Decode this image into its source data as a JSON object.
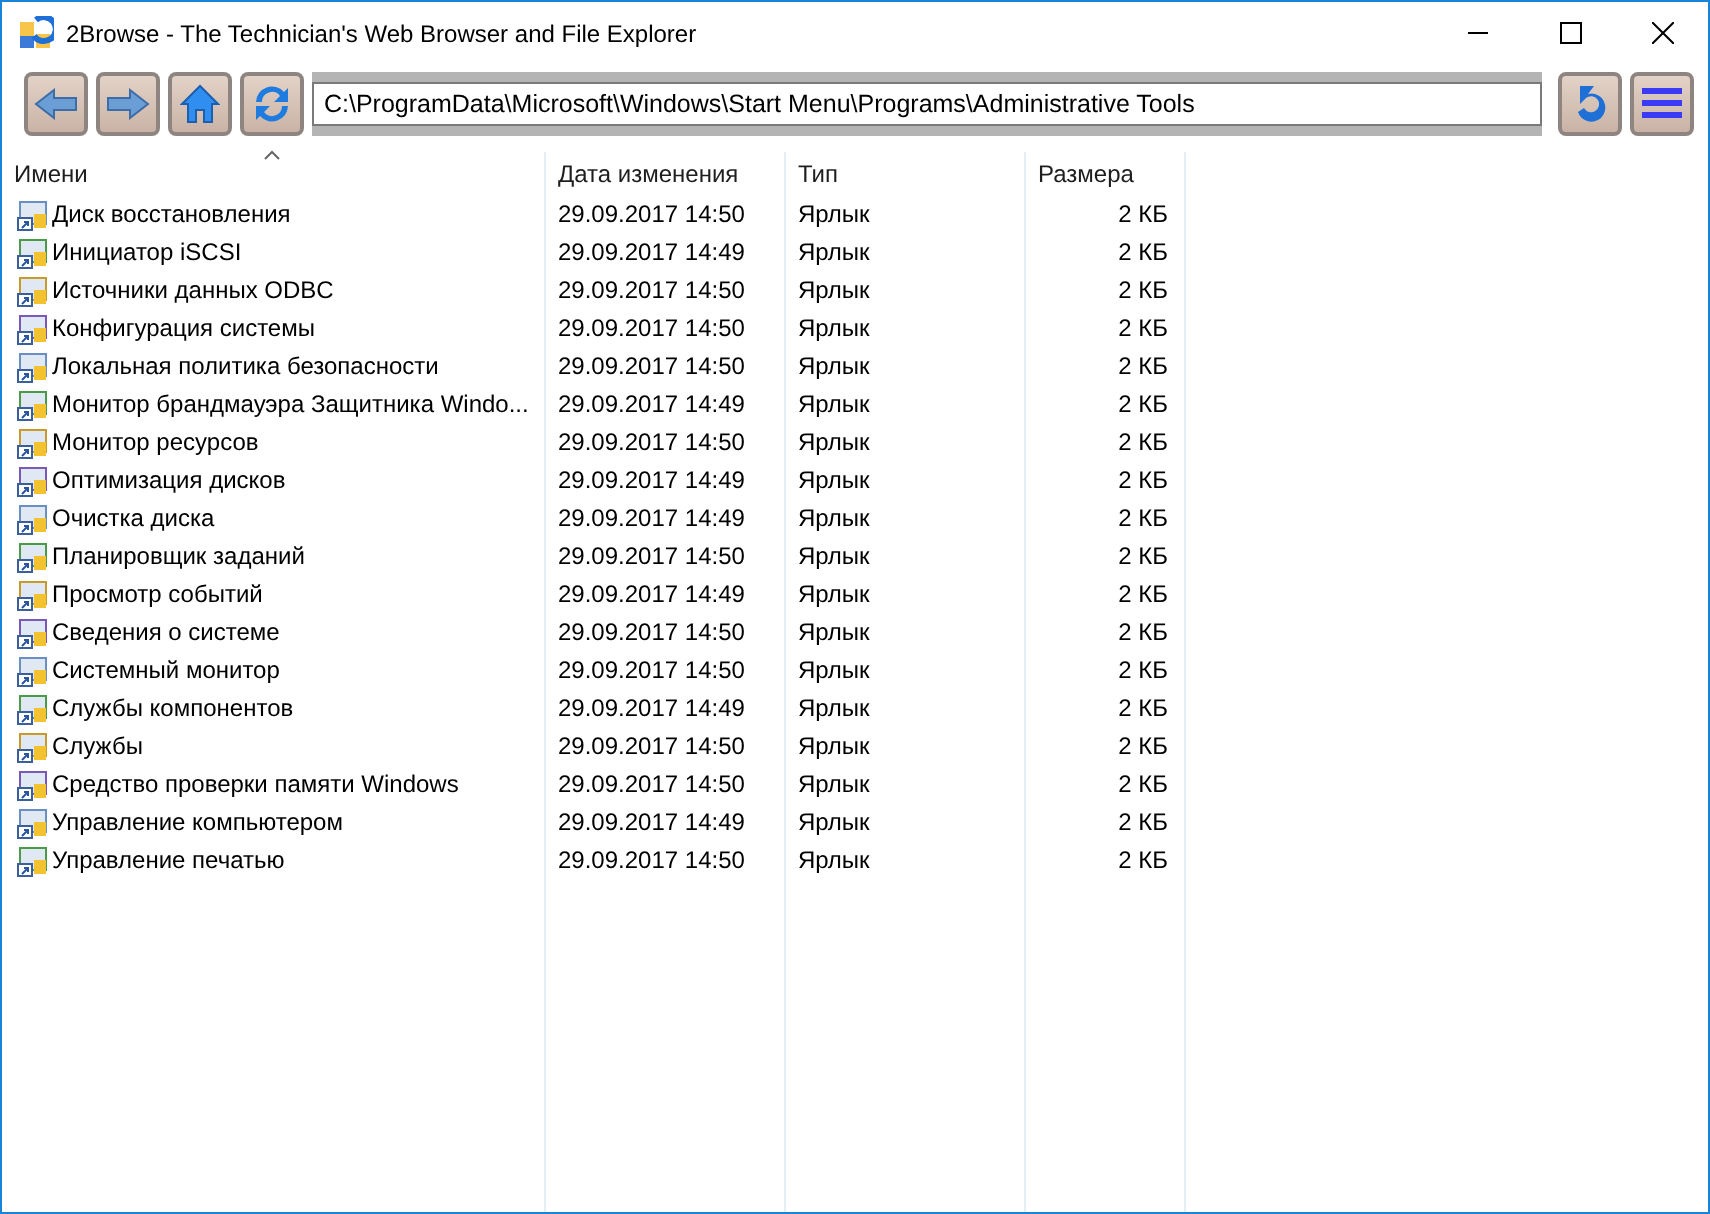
{
  "window": {
    "title": "2Browse - The Technician's Web Browser and File Explorer"
  },
  "address": "C:\\ProgramData\\Microsoft\\Windows\\Start Menu\\Programs\\Administrative Tools",
  "columns": [
    "Имени",
    "Дата изменения",
    "Тип",
    "Размера"
  ],
  "rows": [
    {
      "name": "Диск восстановления",
      "date": "29.09.2017 14:50",
      "type": "Ярлык",
      "size": "2 КБ"
    },
    {
      "name": "Инициатор iSCSI",
      "date": "29.09.2017 14:49",
      "type": "Ярлык",
      "size": "2 КБ"
    },
    {
      "name": "Источники данных ODBC",
      "date": "29.09.2017 14:50",
      "type": "Ярлык",
      "size": "2 КБ"
    },
    {
      "name": "Конфигурация системы",
      "date": "29.09.2017 14:50",
      "type": "Ярлык",
      "size": "2 КБ"
    },
    {
      "name": "Локальная политика безопасности",
      "date": "29.09.2017 14:50",
      "type": "Ярлык",
      "size": "2 КБ"
    },
    {
      "name": "Монитор брандмауэра Защитника Windo...",
      "date": "29.09.2017 14:49",
      "type": "Ярлык",
      "size": "2 КБ"
    },
    {
      "name": "Монитор ресурсов",
      "date": "29.09.2017 14:50",
      "type": "Ярлык",
      "size": "2 КБ"
    },
    {
      "name": "Оптимизация дисков",
      "date": "29.09.2017 14:49",
      "type": "Ярлык",
      "size": "2 КБ"
    },
    {
      "name": "Очистка диска",
      "date": "29.09.2017 14:49",
      "type": "Ярлык",
      "size": "2 КБ"
    },
    {
      "name": "Планировщик заданий",
      "date": "29.09.2017 14:50",
      "type": "Ярлык",
      "size": "2 КБ"
    },
    {
      "name": "Просмотр событий",
      "date": "29.09.2017 14:49",
      "type": "Ярлык",
      "size": "2 КБ"
    },
    {
      "name": "Сведения о системе",
      "date": "29.09.2017 14:50",
      "type": "Ярлык",
      "size": "2 КБ"
    },
    {
      "name": "Системный монитор",
      "date": "29.09.2017 14:50",
      "type": "Ярлык",
      "size": "2 КБ"
    },
    {
      "name": "Службы компонентов",
      "date": "29.09.2017 14:49",
      "type": "Ярлык",
      "size": "2 КБ"
    },
    {
      "name": "Службы",
      "date": "29.09.2017 14:50",
      "type": "Ярлык",
      "size": "2 КБ"
    },
    {
      "name": "Средство проверки памяти Windows",
      "date": "29.09.2017 14:50",
      "type": "Ярлык",
      "size": "2 КБ"
    },
    {
      "name": "Управление компьютером",
      "date": "29.09.2017 14:49",
      "type": "Ярлык",
      "size": "2 КБ"
    },
    {
      "name": "Управление печатью",
      "date": "29.09.2017 14:50",
      "type": "Ярлык",
      "size": "2 КБ"
    }
  ]
}
